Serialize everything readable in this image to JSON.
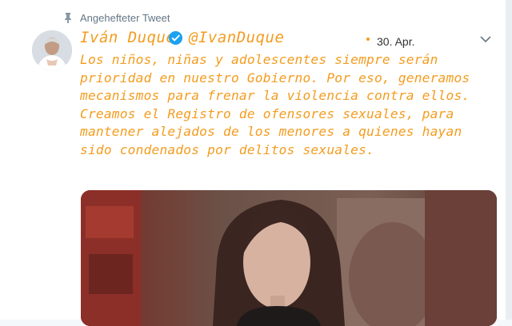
{
  "pinned": {
    "label": "Angehefteter Tweet",
    "icon": "pin-icon"
  },
  "author": {
    "name": "Iván Duque",
    "handle": "@IvanDuque",
    "verified_icon": "verified-badge-icon"
  },
  "tweet": {
    "date": "30. Apr.",
    "text": "Los niños, niñas y adolescentes siempre serán prioridad en nuestro Gobierno. Por eso, generamos mecanismos para frenar la violencia contra ellos. Creamos el Registro de ofensores sexuales, para mantener alejados de los menores a quienes hayan sido condenados por delitos sexuales."
  },
  "colors": {
    "text_accent": "#f39c1f",
    "secondary": "#657786",
    "verified": "#1da1f2"
  }
}
